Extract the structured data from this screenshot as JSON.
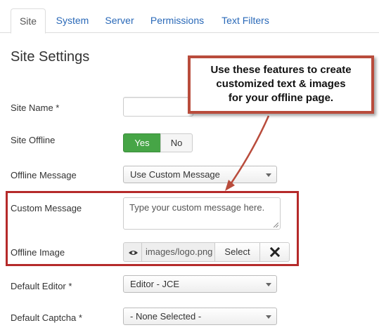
{
  "tabs": [
    {
      "label": "Site",
      "active": true
    },
    {
      "label": "System",
      "active": false
    },
    {
      "label": "Server",
      "active": false
    },
    {
      "label": "Permissions",
      "active": false
    },
    {
      "label": "Text Filters",
      "active": false
    }
  ],
  "section_title": "Site Settings",
  "fields": {
    "site_name": {
      "label": "Site Name *",
      "value": ""
    },
    "site_offline": {
      "label": "Site Offline",
      "yes": "Yes",
      "no": "No",
      "selected": "Yes"
    },
    "offline_message": {
      "label": "Offline Message",
      "value": "Use Custom Message"
    },
    "custom_message": {
      "label": "Custom Message",
      "placeholder": "Type your custom message here."
    },
    "offline_image": {
      "label": "Offline Image",
      "value": "images/logo.png",
      "select_label": "Select",
      "clear_icon": "close-icon",
      "preview_icon": "eye-icon"
    },
    "default_editor": {
      "label": "Default Editor *",
      "value": "Editor - JCE"
    },
    "default_captcha": {
      "label": "Default Captcha *",
      "value": "- None Selected -"
    }
  },
  "callout": {
    "lines": [
      "Use these features to create",
      "customized text & images",
      "for your offline page."
    ]
  },
  "colors": {
    "accent_green": "#46a546",
    "link_blue": "#2a69b8",
    "highlight_red": "#b52a2a"
  }
}
